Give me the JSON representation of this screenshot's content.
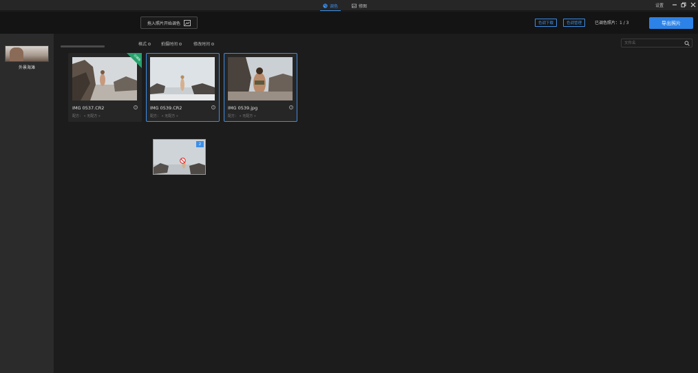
{
  "titlebar": {
    "tabs": [
      {
        "label": "调色",
        "icon": "palette-icon",
        "active": true
      },
      {
        "label": "修图",
        "icon": "image-edit-icon",
        "active": false
      }
    ],
    "settings_label": "设置"
  },
  "toolbar": {
    "import_label": "拖入照片开始调色",
    "preset_download_label": "色调下载",
    "preset_manage_label": "色调管理",
    "count_label": "已调色照片：1 / 3",
    "export_label": "导出照片"
  },
  "sidebar": {
    "album_label": "外景海滩"
  },
  "filters": {
    "sort_items": [
      "格式",
      "拍摄时间",
      "修改时间"
    ],
    "search_placeholder": "文件名"
  },
  "photos": [
    {
      "name": "IMG 0537.CR2",
      "sub": "配方： « 无配方 »",
      "selected": false,
      "badge": "已调色"
    },
    {
      "name": "IMG 0539.CR2",
      "sub": "配方： « 无配方 »",
      "selected": true,
      "badge": ""
    },
    {
      "name": "IMG 0539.jpg",
      "sub": "配方： « 无配方 »",
      "selected": true,
      "badge": ""
    }
  ],
  "drag": {
    "count": "2"
  },
  "colors": {
    "accent": "#3d8fe8",
    "export_button": "#2c82e6",
    "badge_green": "#26a26b"
  }
}
